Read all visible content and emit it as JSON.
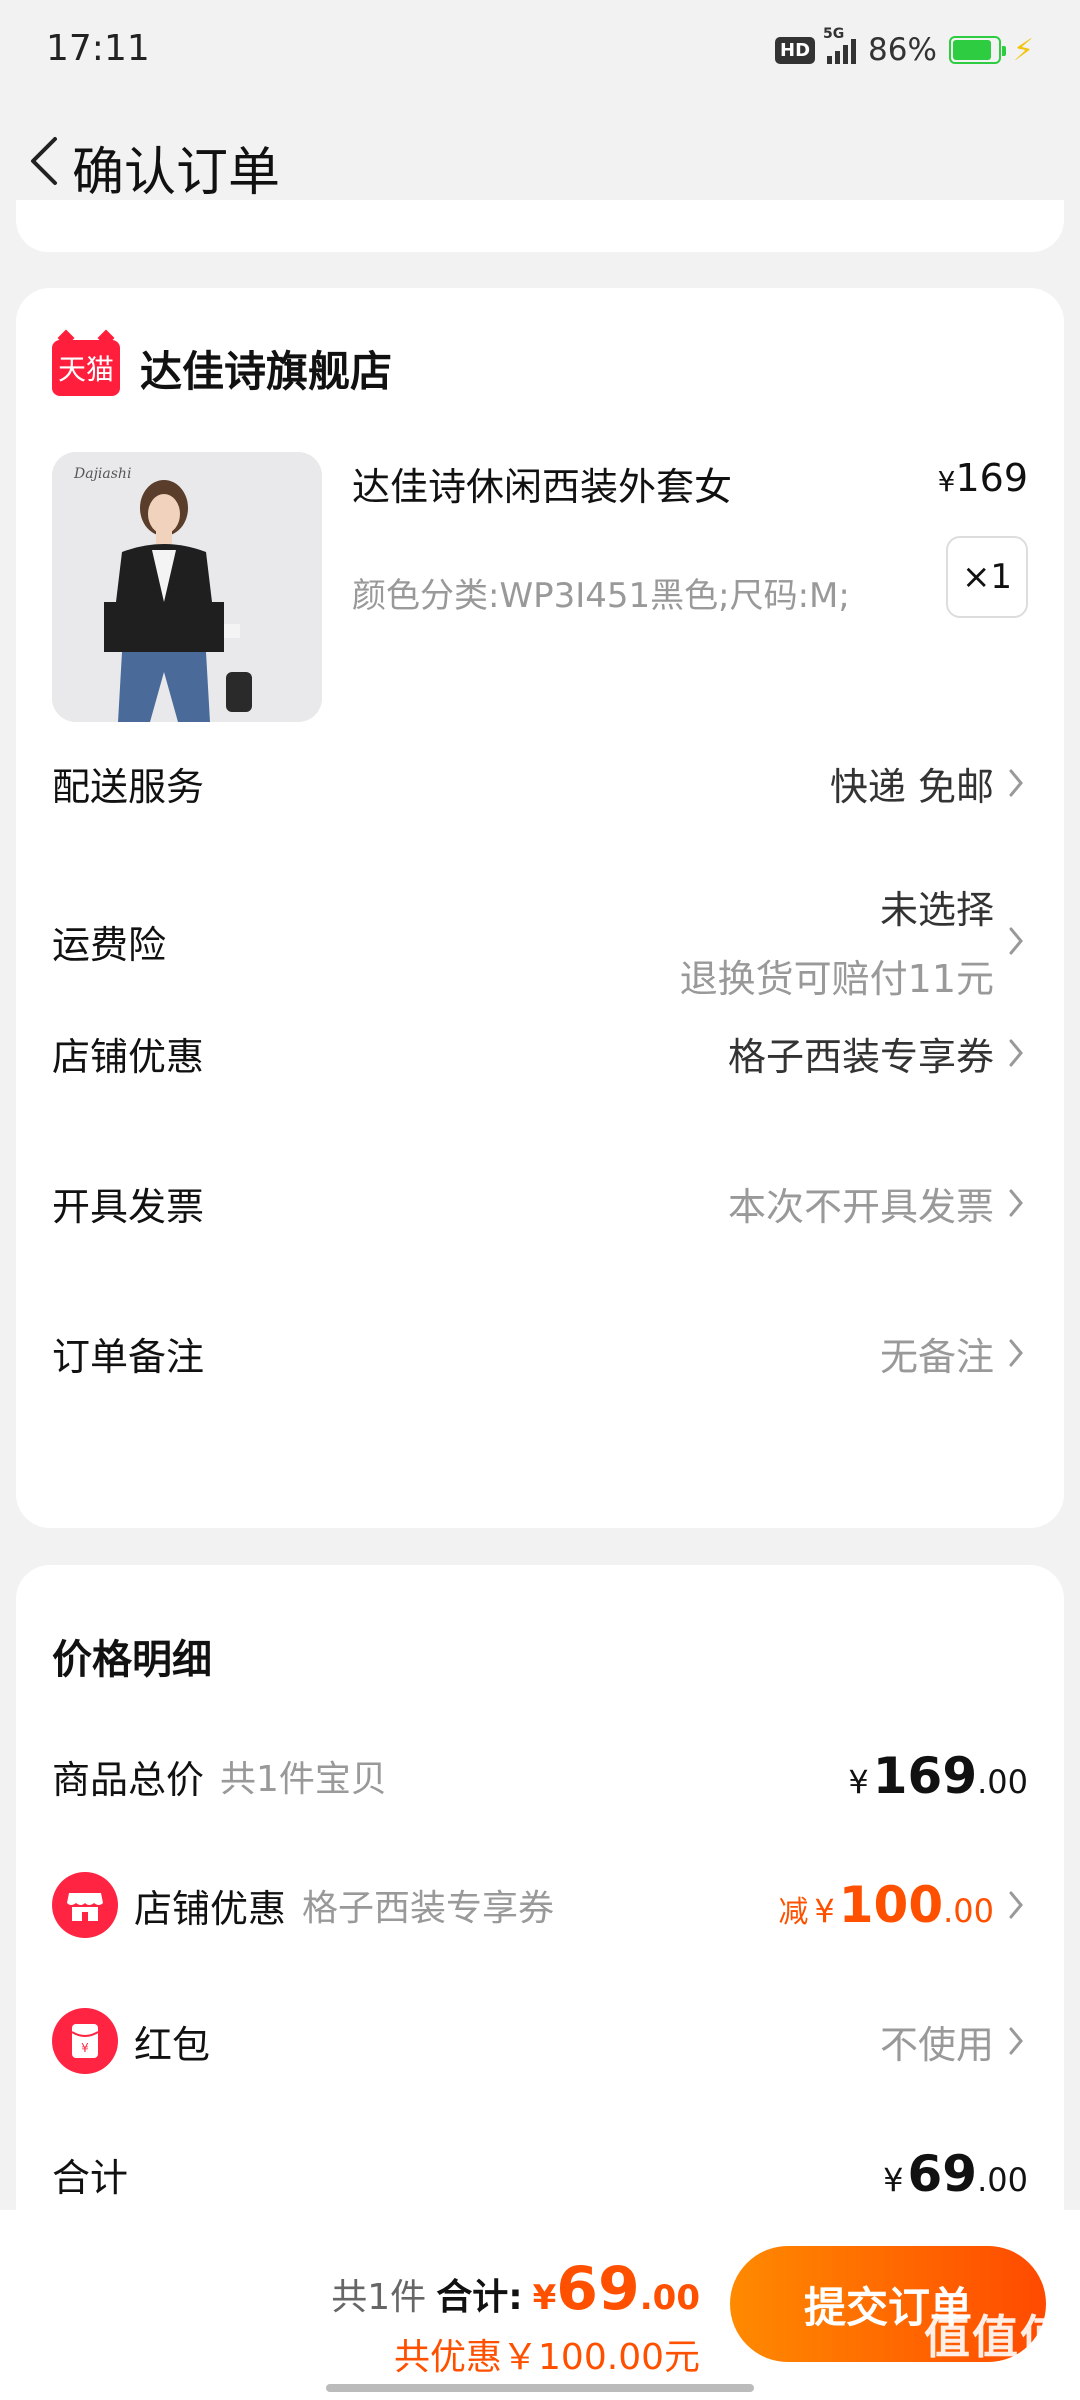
{
  "status_bar": {
    "time": "17:11",
    "network_badge": "HD",
    "network_type": "5G",
    "battery_percent": "86%",
    "battery_level": 0.86
  },
  "header": {
    "title": "确认订单",
    "back_icon": "chevron-left-icon"
  },
  "order": {
    "shop_badge": "天猫",
    "shop_name": "达佳诗旗舰店",
    "product": {
      "title": "达佳诗休闲西装外套女",
      "price_symbol": "¥",
      "price": "169",
      "sku": "颜色分类:WP3I451黑色;尺码:M;",
      "quantity": "×1"
    },
    "options": [
      {
        "label": "配送服务",
        "value": "快递 免邮",
        "sub": ""
      },
      {
        "label": "运费险",
        "value": "未选择",
        "sub": "退换货可赔付11元"
      },
      {
        "label": "店铺优惠",
        "value": "格子西装专享券",
        "sub": ""
      },
      {
        "label": "开具发票",
        "value": "本次不开具发票",
        "sub": ""
      },
      {
        "label": "订单备注",
        "value": "无备注",
        "sub": ""
      }
    ]
  },
  "price_detail": {
    "title": "价格明细",
    "rows": [
      {
        "label": "商品总价",
        "sub": "共1件宝贝",
        "prefix": "",
        "yen": "¥",
        "int": "169",
        "dec": ".00"
      },
      {
        "label": "店铺优惠",
        "sub": "格子西装专享券",
        "prefix": "减",
        "yen": "¥",
        "int": "100",
        "dec": ".00"
      },
      {
        "label": "红包",
        "sub": "",
        "value": "不使用"
      },
      {
        "label": "合计",
        "yen": "¥",
        "int": "69",
        "dec": ".00"
      }
    ]
  },
  "bottom_bar": {
    "count": "共1件",
    "total_label": "合计:",
    "total_yen": "¥",
    "total_int": "69",
    "total_dec": ".00",
    "saved": "共优惠￥100.00元",
    "submit": "提交订单"
  },
  "colors": {
    "accent": "#ff5000",
    "tmall_red": "#ff1f3d",
    "background": "#f2f2f2"
  }
}
